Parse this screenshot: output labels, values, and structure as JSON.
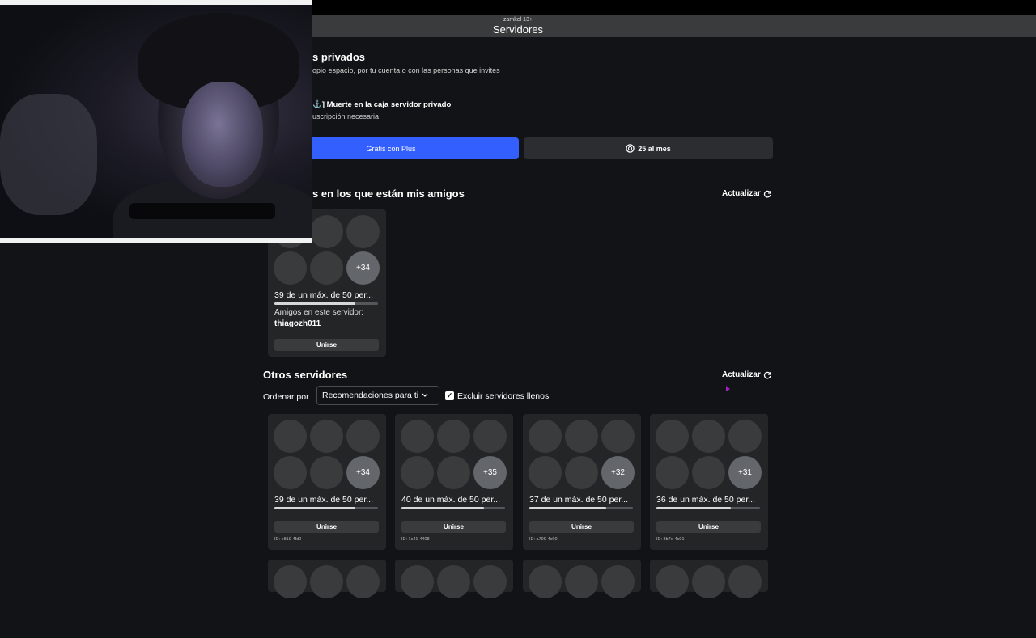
{
  "window": {
    "subtitle": "zamkel 13+",
    "title": "Servidores"
  },
  "private": {
    "title": "s privados",
    "desc": "opio espacio, por tu cuenta o con las personas que invites",
    "item_title": "⚓] Muerte en la caja servidor privado",
    "item_sub": "uscripción necesaria",
    "plus_button": "Gratis con Plus",
    "buy_button": "25 al mes",
    "robux_icon": "robux-icon"
  },
  "friends_section": {
    "title": "s en los que están mis amigos",
    "refresh": "Actualizar",
    "card": {
      "more": "+34",
      "caption": "39 de un máx. de 50 per...",
      "fill": 0.78,
      "friends_label": "Amigos en este servidor:",
      "friends_name": "thiagozh011",
      "join": "Unirse"
    }
  },
  "others": {
    "title": "Otros servidores",
    "refresh": "Actualizar",
    "sort_label": "Ordenar por",
    "sort_value": "Recomendaciones para ti",
    "exclude_label": "Excluir servidores llenos",
    "exclude_checked": true,
    "cards": [
      {
        "more": "+34",
        "caption": "39 de un máx. de 50 per...",
        "fill": 0.78,
        "join": "Unirse",
        "id": "ID: e819-4fd0"
      },
      {
        "more": "+35",
        "caption": "40 de un máx. de 50 per...",
        "fill": 0.8,
        "join": "Unirse",
        "id": "ID: 1c41-4408"
      },
      {
        "more": "+32",
        "caption": "37 de un máx. de 50 per...",
        "fill": 0.74,
        "join": "Unirse",
        "id": "ID: a799-4c90"
      },
      {
        "more": "+31",
        "caption": "36 de un máx. de 50 per...",
        "fill": 0.72,
        "join": "Unirse",
        "id": "ID: 8b7e-4c01"
      }
    ]
  },
  "colors": {
    "accent": "#335fff",
    "background": "#121316",
    "card": "#232527"
  }
}
